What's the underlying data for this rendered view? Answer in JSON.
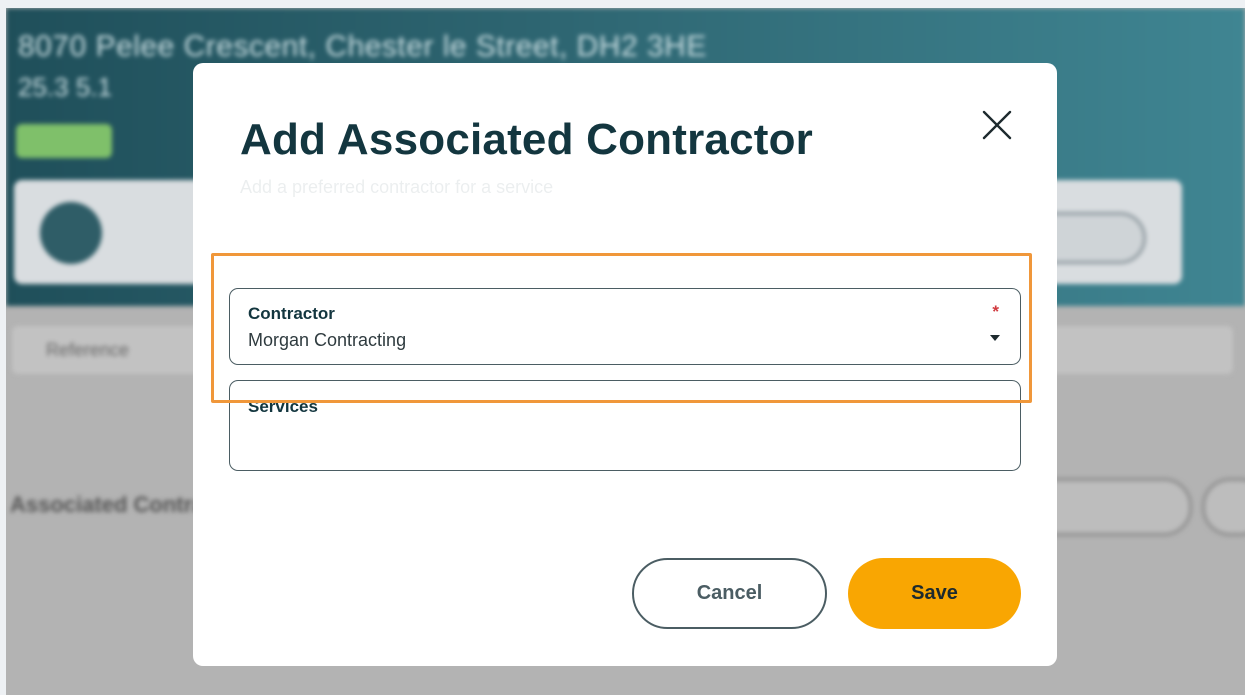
{
  "background": {
    "title": "8070 Pelee Crescent, Chester le Street, DH2 3HE",
    "subtitle": "25.3   5.1",
    "filter_label": "Reference",
    "section_title": "Associated Contractors"
  },
  "modal": {
    "title": "Add Associated Contractor",
    "subtitle": "Add a preferred contractor for a service",
    "close_icon": "close-icon"
  },
  "form": {
    "contractor": {
      "label": "Contractor",
      "required_mark": "*",
      "value": "Morgan Contracting"
    },
    "services": {
      "label": "Services",
      "value": ""
    }
  },
  "actions": {
    "cancel_label": "Cancel",
    "save_label": "Save"
  },
  "colors": {
    "primary_text": "#13363f",
    "save_button": "#f9a602",
    "highlight": "#f0973a",
    "required": "#d0393e"
  }
}
